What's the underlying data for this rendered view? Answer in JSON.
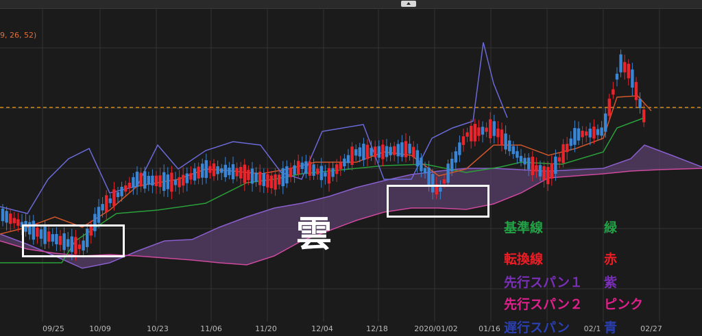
{
  "params_label": "9, 26, 52)",
  "cloud_label": "雲",
  "legend": [
    {
      "name": "基準線",
      "color_name": "緑",
      "name_color": "#22a346",
      "color_color": "#22a346"
    },
    {
      "name": "転換線",
      "color_name": "赤",
      "name_color": "#ee1c25",
      "color_color": "#ee1c25"
    },
    {
      "name": "先行スパン１",
      "color_name": "紫",
      "name_color": "#7a2fb8",
      "color_color": "#7a2fb8"
    },
    {
      "name": "先行スパン２",
      "color_name": "ピンク",
      "name_color": "#e0208c",
      "color_color": "#e0208c"
    },
    {
      "name": "遅行スパン",
      "color_name": "青",
      "name_color": "#2a3fb0",
      "color_color": "#2a3fb0"
    }
  ],
  "chart_data": {
    "type": "candlestick",
    "x_tick_labels": [
      "09/25",
      "10/09",
      "10/23",
      "11/06",
      "11/20",
      "12/04",
      "12/18",
      "2020/01/02",
      "01/16",
      "02/1",
      "02/27"
    ],
    "grid": true,
    "colors": {
      "up": "#e8242c",
      "down": "#3a86d4",
      "kijun": "#2aa13a",
      "tenkan": "#d2572a",
      "span1": "#8a5fd0",
      "span2": "#d04aa0",
      "chikou": "#6a6ad8",
      "reference_line": "#d08a1a",
      "cloud": "#5a3f6a"
    },
    "price_levels": {
      "reference_line": 0.5
    }
  }
}
